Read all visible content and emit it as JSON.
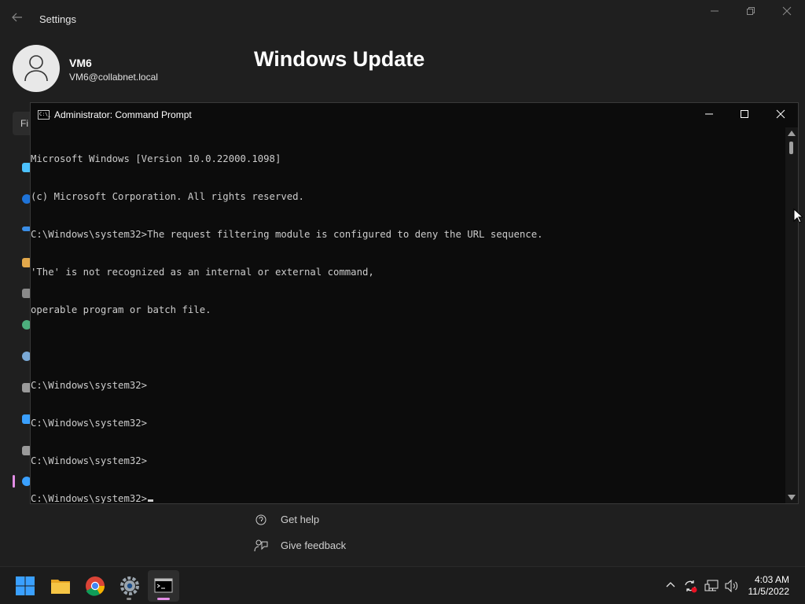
{
  "settings": {
    "title": "Settings",
    "user_name": "VM6",
    "user_email": "VM6@collabnet.local",
    "page_title": "Windows Update",
    "find_placeholder": "Fi",
    "help_links": [
      {
        "label": "Get help",
        "icon": "help-icon"
      },
      {
        "label": "Give feedback",
        "icon": "feedback-icon"
      }
    ]
  },
  "cmd": {
    "title": "Administrator: Command Prompt",
    "icon_text": "C:\\_",
    "lines": [
      "Microsoft Windows [Version 10.0.22000.1098]",
      "(c) Microsoft Corporation. All rights reserved.",
      "C:\\Windows\\system32>The request filtering module is configured to deny the URL sequence.",
      "'The' is not recognized as an internal or external command,",
      "operable program or batch file.",
      "",
      "C:\\Windows\\system32>",
      "C:\\Windows\\system32>",
      "C:\\Windows\\system32>",
      "C:\\Windows\\system32>"
    ]
  },
  "taskbar": {
    "apps": [
      "start-icon",
      "file-explorer-icon",
      "chrome-icon",
      "settings-icon",
      "command-prompt-icon"
    ],
    "clock": {
      "time": "4:03 AM",
      "date": "11/5/2022"
    }
  },
  "colors": {
    "accent": "#e38ee6",
    "terminal_bg": "#0c0c0c",
    "terminal_text": "#cccccc",
    "start_blue": "#3aa0ff"
  }
}
